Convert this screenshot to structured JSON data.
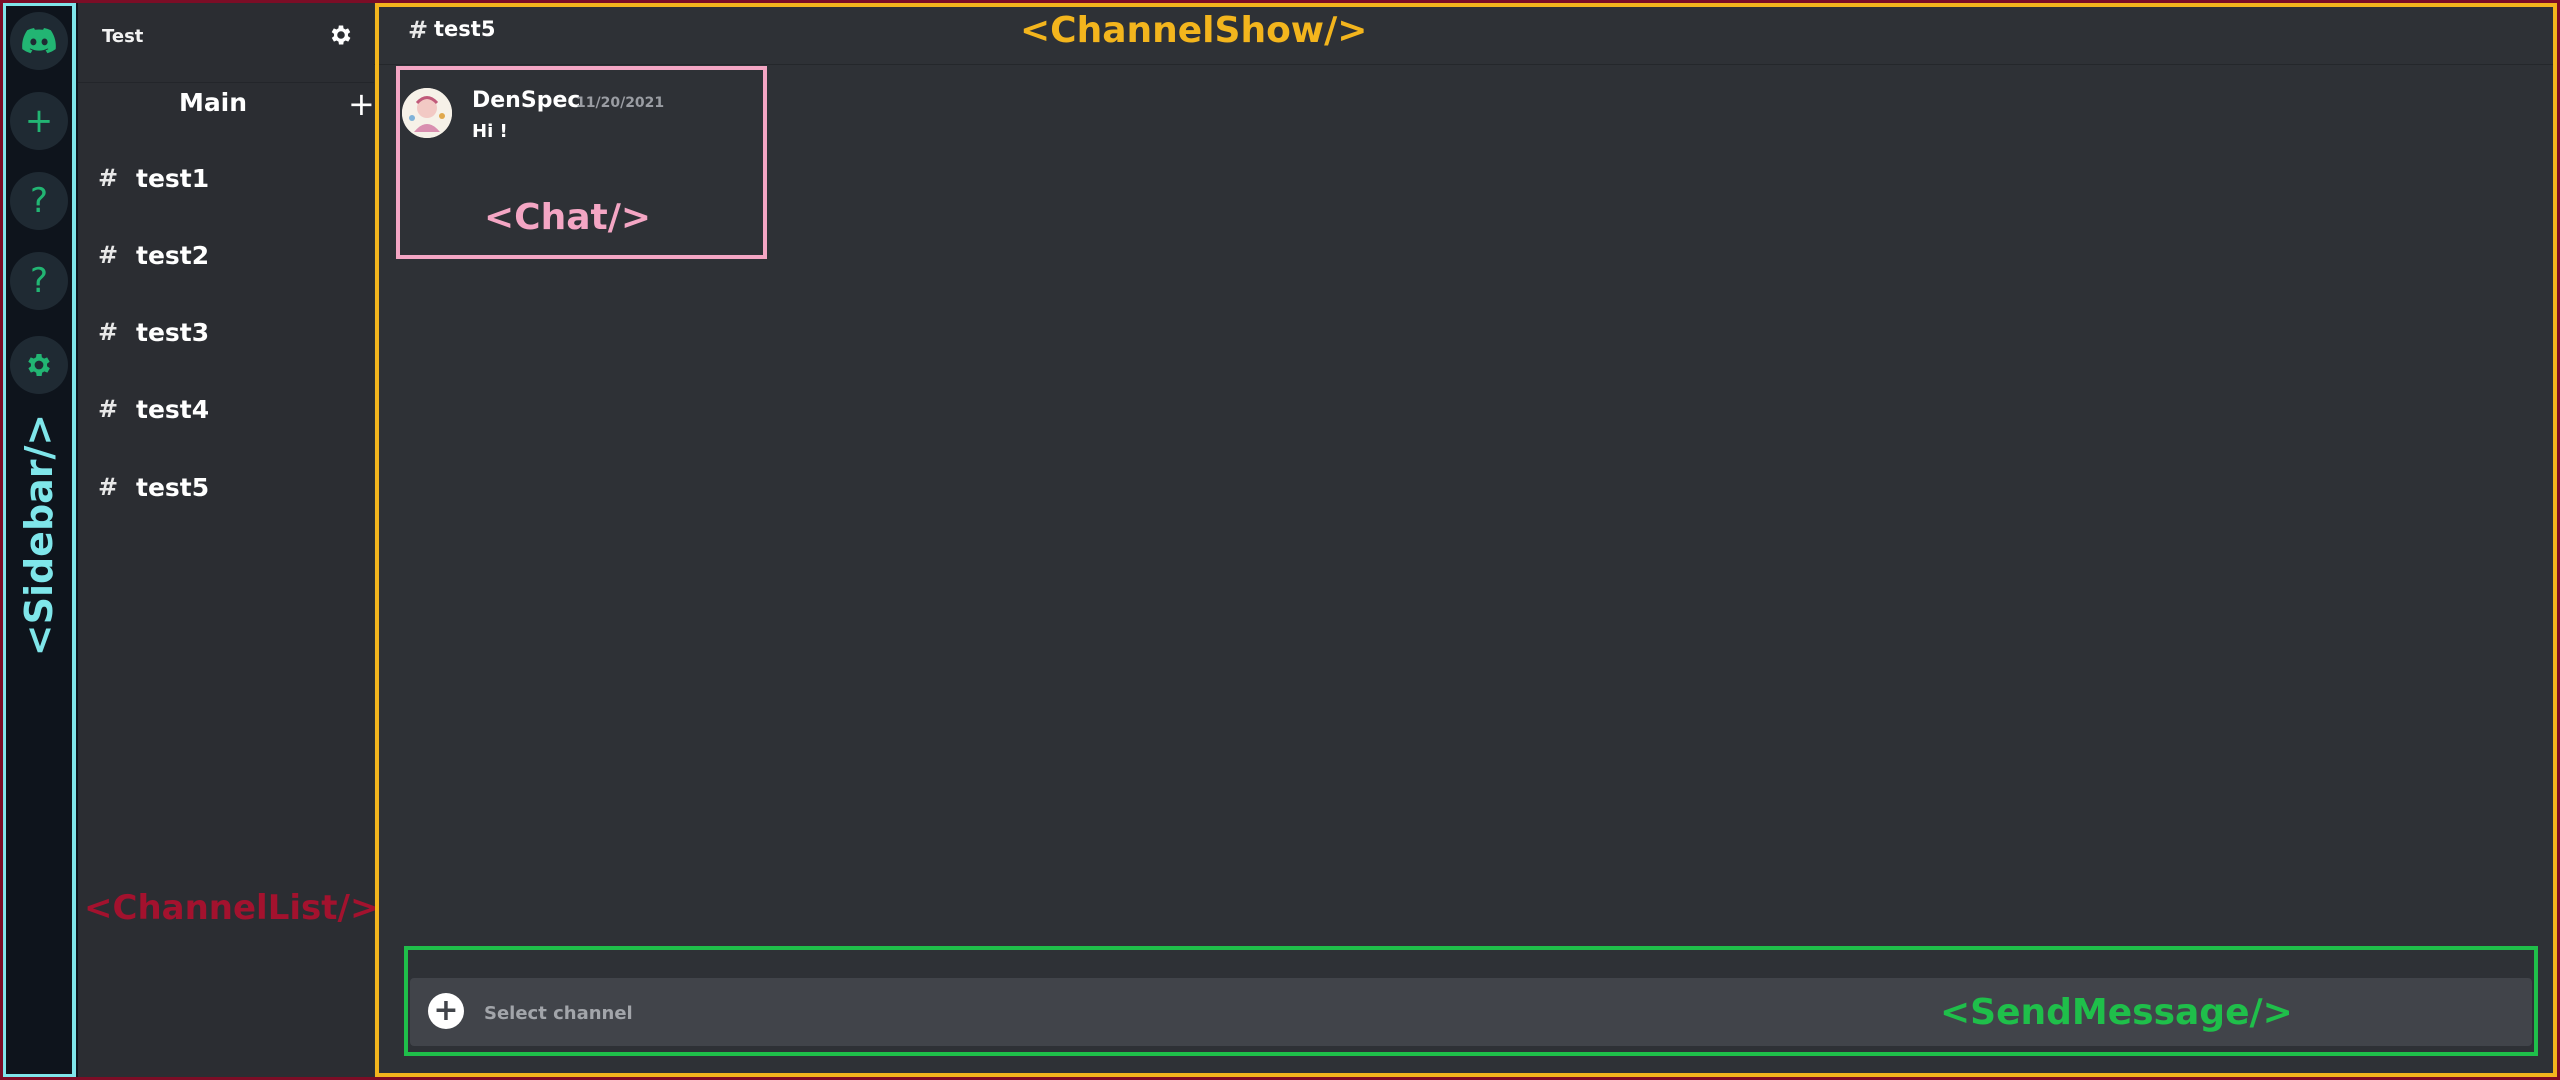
{
  "sidebar": {
    "label": "<Sidebar/>",
    "buttons": {
      "home_icon": "discord-logo",
      "add": "+",
      "help1": "?",
      "help2": "?",
      "settings_icon": "gear"
    }
  },
  "channel_list": {
    "server_name": "Test",
    "category": "Main",
    "add_symbol": "+",
    "hash": "#",
    "channels": [
      "test1",
      "test2",
      "test3",
      "test4",
      "test5"
    ],
    "label": "<ChannelList/>"
  },
  "channel_show": {
    "hash": "#",
    "channel_name": "test5",
    "label": "<ChannelShow/>"
  },
  "chat": {
    "author": "DenSpec",
    "timestamp": "11/20/2021",
    "text": "Hi !",
    "label": "<Chat/>"
  },
  "send_message": {
    "plus": "+",
    "placeholder": "Select channel",
    "label": "<SendMessage/>"
  },
  "colors": {
    "sidebar_bg": "#0e141c",
    "channel_list_bg": "#2b2d32",
    "main_bg": "#2e3136",
    "accent_green": "#22b573",
    "sidebar_frame": "#7fe6ea",
    "channellist_frame": "#7b0d26",
    "channelshow_frame": "#f3b51d",
    "chat_frame": "#f4a6c4",
    "sendmessage_frame": "#1fbf4a"
  }
}
